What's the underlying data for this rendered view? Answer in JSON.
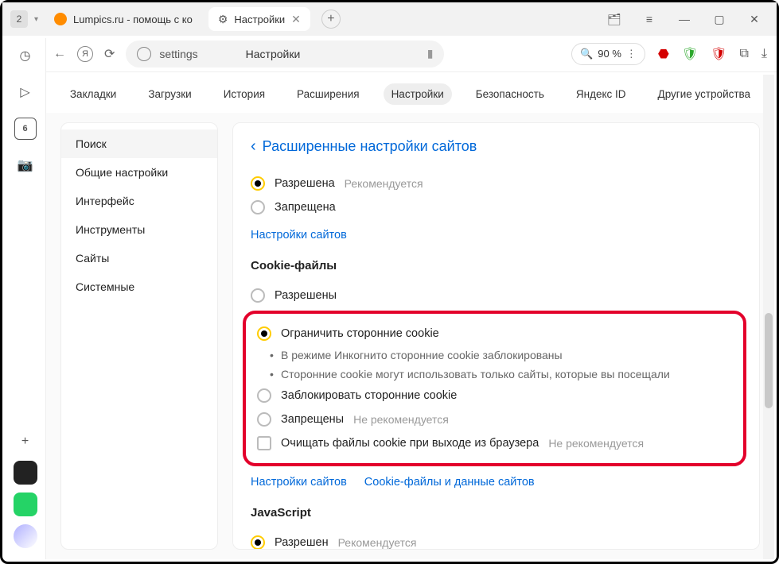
{
  "titlebar": {
    "tab_count": "2",
    "tab1_label": "Lumpics.ru - помощь с ко",
    "tab2_label": "Настройки"
  },
  "addressbar": {
    "url_text": "settings",
    "page_title": "Настройки",
    "zoom": "90 %"
  },
  "topnav": {
    "items": [
      "Закладки",
      "Загрузки",
      "История",
      "Расширения",
      "Настройки",
      "Безопасность",
      "Яндекс ID",
      "Другие устройства"
    ]
  },
  "sidebar": {
    "items": [
      "Поиск",
      "Общие настройки",
      "Интерфейс",
      "Инструменты",
      "Сайты",
      "Системные"
    ]
  },
  "pane": {
    "heading": "Расширенные настройки сайтов",
    "sec1": {
      "opt1": "Разрешена",
      "opt1_hint": "Рекомендуется",
      "opt2": "Запрещена",
      "link": "Настройки сайтов"
    },
    "sec2_title": "Cookie-файлы",
    "sec2": {
      "opt1": "Разрешены",
      "opt2": "Ограничить сторонние cookie",
      "sub1": "В режиме Инкогнито сторонние cookie заблокированы",
      "sub2": "Сторонние cookie могут использовать только сайты, которые вы посещали",
      "opt3": "Заблокировать сторонние cookie",
      "opt4": "Запрещены",
      "opt4_hint": "Не рекомендуется",
      "chk": "Очищать файлы cookie при выходе из браузера",
      "chk_hint": "Не рекомендуется",
      "link1": "Настройки сайтов",
      "link2": "Cookie-файлы и данные сайтов"
    },
    "sec3_title": "JavaScript",
    "sec3": {
      "opt1": "Разрешен",
      "opt1_hint": "Рекомендуется"
    }
  },
  "left_strip": {
    "tab_num": "6"
  }
}
